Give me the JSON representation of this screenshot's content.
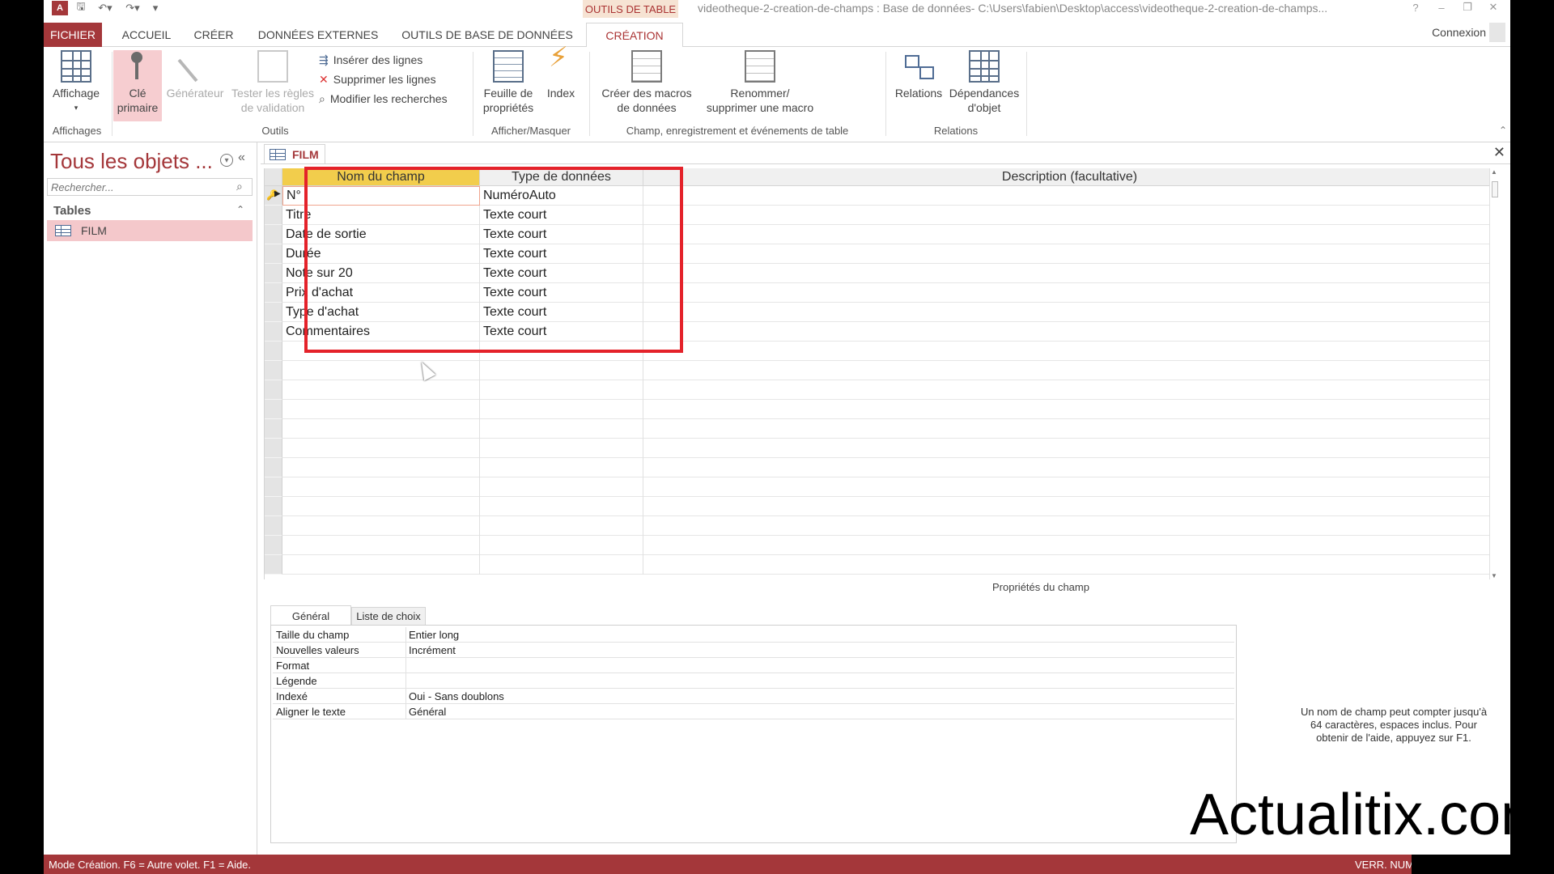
{
  "titlebar": {
    "context_tab": "OUTILS DE TABLE",
    "title": "videotheque-2-creation-de-champs : Base de données- C:\\Users\\fabien\\Desktop\\access\\videotheque-2-creation-de-champs...",
    "help": "?",
    "minimize": "–",
    "restore": "❐",
    "close": "✕"
  },
  "ribbon_tabs": {
    "file": "FICHIER",
    "home": "ACCUEIL",
    "create": "CRÉER",
    "external": "DONNÉES EXTERNES",
    "tools": "OUTILS DE BASE DE DONNÉES",
    "design": "CRÉATION",
    "signin": "Connexion"
  },
  "ribbon": {
    "views_btn": "Affichage",
    "primary_key_line1": "Clé",
    "primary_key_line2": "primaire",
    "builder": "Générateur",
    "test_rules_line1": "Tester les règles",
    "test_rules_line2": "de validation",
    "insert_rows": "Insérer des lignes",
    "delete_rows": "Supprimer les lignes",
    "modify_lookups": "Modifier les recherches",
    "property_sheet_line1": "Feuille de",
    "property_sheet_line2": "propriétés",
    "indexes": "Index",
    "create_macros_line1": "Créer des macros",
    "create_macros_line2": "de données",
    "rename_macro_line1": "Renommer/",
    "rename_macro_line2": "supprimer une macro",
    "relationships": "Relations",
    "dependencies_line1": "Dépendances",
    "dependencies_line2": "d'objet",
    "groups": {
      "views": "Affichages",
      "tools": "Outils",
      "show_hide": "Afficher/Masquer",
      "field_events": "Champ, enregistrement et événements de table",
      "relationships": "Relations"
    }
  },
  "nav": {
    "title": "Tous les objets ...",
    "search_placeholder": "Rechercher...",
    "group": "Tables",
    "items": [
      {
        "label": "FILM"
      }
    ]
  },
  "doc": {
    "tab_label": "FILM"
  },
  "grid": {
    "headers": {
      "name": "Nom du champ",
      "type": "Type de données",
      "description": "Description (facultative)"
    },
    "rows": [
      {
        "name": "N°",
        "type": "NuméroAuto"
      },
      {
        "name": "Titre",
        "type": "Texte court"
      },
      {
        "name": "Date de sortie",
        "type": "Texte court"
      },
      {
        "name": "Durée",
        "type": "Texte court"
      },
      {
        "name": "Note sur 20",
        "type": "Texte court"
      },
      {
        "name": "Prix d'achat",
        "type": "Texte court"
      },
      {
        "name": "Type d'achat",
        "type": "Texte court"
      },
      {
        "name": "Commentaires",
        "type": "Texte court"
      }
    ]
  },
  "properties": {
    "title": "Propriétés du champ",
    "tab_general": "Général",
    "tab_lookup": "Liste de choix",
    "rows": [
      {
        "label": "Taille du champ",
        "value": "Entier long"
      },
      {
        "label": "Nouvelles valeurs",
        "value": "Incrément"
      },
      {
        "label": "Format",
        "value": ""
      },
      {
        "label": "Légende",
        "value": ""
      },
      {
        "label": "Indexé",
        "value": "Oui - Sans doublons"
      },
      {
        "label": "Aligner le texte",
        "value": "Général"
      }
    ],
    "help_text": "Un nom de champ peut compter jusqu'à 64 caractères, espaces inclus. Pour obtenir de l'aide, appuyez sur F1."
  },
  "watermark": "Actualitix.com",
  "status": {
    "left": "Mode Création. F6 = Autre volet. F1 = Aide.",
    "right": "VERR. NUM"
  },
  "colors": {
    "accent": "#a4373a",
    "header_selected": "#f2cd4c",
    "highlight_box": "#e4222a"
  }
}
